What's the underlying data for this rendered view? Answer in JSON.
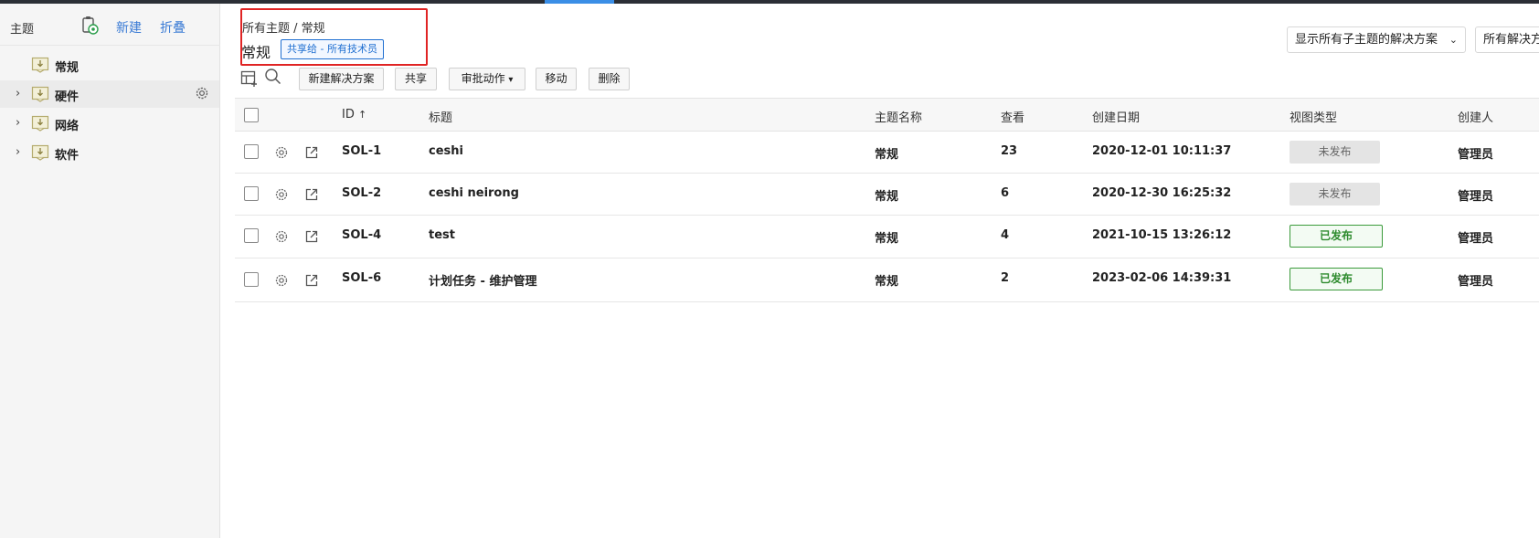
{
  "sidebar": {
    "title": "主题",
    "new_label": "新建",
    "fold_label": "折叠",
    "items": [
      {
        "label": "常规",
        "expandable": false
      },
      {
        "label": "硬件",
        "expandable": true
      },
      {
        "label": "网络",
        "expandable": true
      },
      {
        "label": "软件",
        "expandable": true
      }
    ]
  },
  "header": {
    "breadcrumb": "所有主题 / 常规",
    "title": "常规",
    "share_badge": "共享给 - 所有技术员",
    "filter_dropdown": "显示所有子主题的解决方案",
    "second_dropdown": "所有解决方"
  },
  "toolbar": {
    "new_solution": "新建解决方案",
    "share": "共享",
    "approval": "审批动作",
    "move": "移动",
    "delete": "删除"
  },
  "table": {
    "columns": {
      "id": "ID",
      "title": "标题",
      "topic": "主题名称",
      "views": "查看",
      "created": "创建日期",
      "view_type": "视图类型",
      "creator": "创建人"
    },
    "rows": [
      {
        "id": "SOL-1",
        "title": "ceshi",
        "topic": "常规",
        "views": "23",
        "created": "2020-12-01 10:11:37",
        "status": "未发布",
        "status_type": "unpublished",
        "creator": "管理员"
      },
      {
        "id": "SOL-2",
        "title": "ceshi neirong",
        "topic": "常规",
        "views": "6",
        "created": "2020-12-30 16:25:32",
        "status": "未发布",
        "status_type": "unpublished",
        "creator": "管理员"
      },
      {
        "id": "SOL-4",
        "title": "test",
        "topic": "常规",
        "views": "4",
        "created": "2021-10-15 13:26:12",
        "status": "已发布",
        "status_type": "published",
        "creator": "管理员"
      },
      {
        "id": "SOL-6",
        "title": "计划任务 - 维护管理",
        "topic": "常规",
        "views": "2",
        "created": "2023-02-06 14:39:31",
        "status": "已发布",
        "status_type": "published",
        "creator": "管理员"
      }
    ]
  },
  "colors": {
    "accent": "#3a7bd5",
    "highlight_border": "#e02424",
    "published": "#2e8b2e",
    "unpublished_bg": "#e4e4e4"
  }
}
